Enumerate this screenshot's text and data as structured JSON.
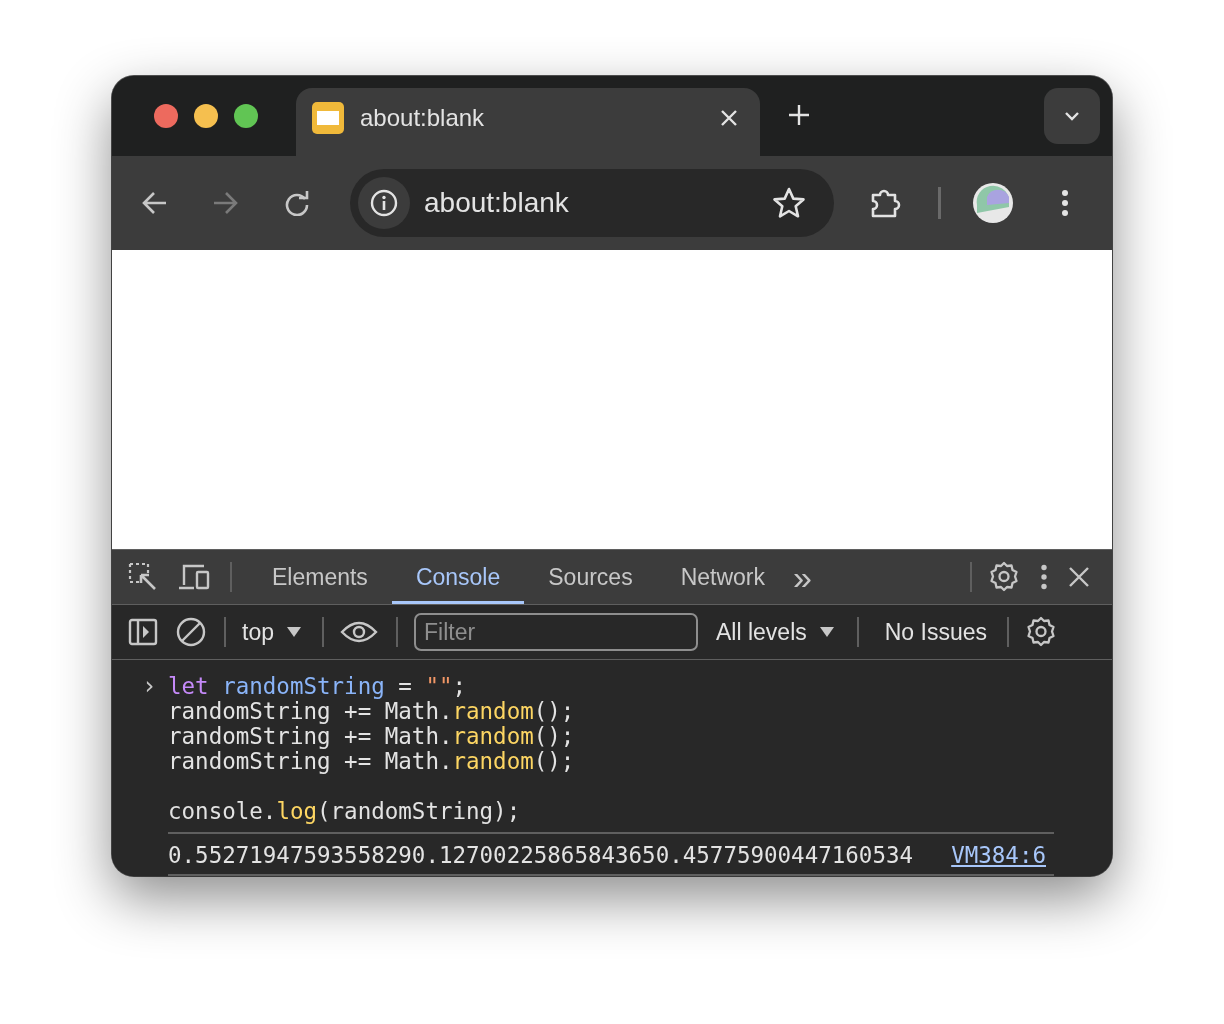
{
  "browser_tab": {
    "title": "about:blank"
  },
  "address_bar": {
    "url": "about:blank"
  },
  "devtools": {
    "tabs": [
      {
        "label": "Elements",
        "selected": false
      },
      {
        "label": "Console",
        "selected": true
      },
      {
        "label": "Sources",
        "selected": false
      },
      {
        "label": "Network",
        "selected": false
      }
    ],
    "more_tabs": "»",
    "context": "top",
    "filter": {
      "placeholder": "Filter"
    },
    "levels": "All levels",
    "issues": "No Issues"
  },
  "console": {
    "prompt": "›",
    "input_lines": [
      {
        "blank_before": false,
        "tokens": [
          {
            "kind": "keyword",
            "text": "let "
          },
          {
            "kind": "variable",
            "text": "randomString"
          },
          {
            "kind": "plain",
            "text": " = "
          },
          {
            "kind": "string",
            "text": "\"\""
          },
          {
            "kind": "plain",
            "text": ";"
          }
        ]
      },
      {
        "blank_before": false,
        "tokens": [
          {
            "kind": "plain",
            "text": "randomString += Math."
          },
          {
            "kind": "function",
            "text": "random"
          },
          {
            "kind": "plain",
            "text": "();"
          }
        ]
      },
      {
        "blank_before": false,
        "tokens": [
          {
            "kind": "plain",
            "text": "randomString += Math."
          },
          {
            "kind": "function",
            "text": "random"
          },
          {
            "kind": "plain",
            "text": "();"
          }
        ]
      },
      {
        "blank_before": false,
        "tokens": [
          {
            "kind": "plain",
            "text": "randomString += Math."
          },
          {
            "kind": "function",
            "text": "random"
          },
          {
            "kind": "plain",
            "text": "();"
          }
        ]
      },
      {
        "blank_before": true,
        "tokens": [
          {
            "kind": "plain",
            "text": "console."
          },
          {
            "kind": "function",
            "text": "log"
          },
          {
            "kind": "plain",
            "text": "(randomString);"
          }
        ]
      }
    ],
    "output": {
      "text": "0.55271947593558290.12700225865843650.45775900447160534",
      "source": "VM384:6"
    }
  }
}
